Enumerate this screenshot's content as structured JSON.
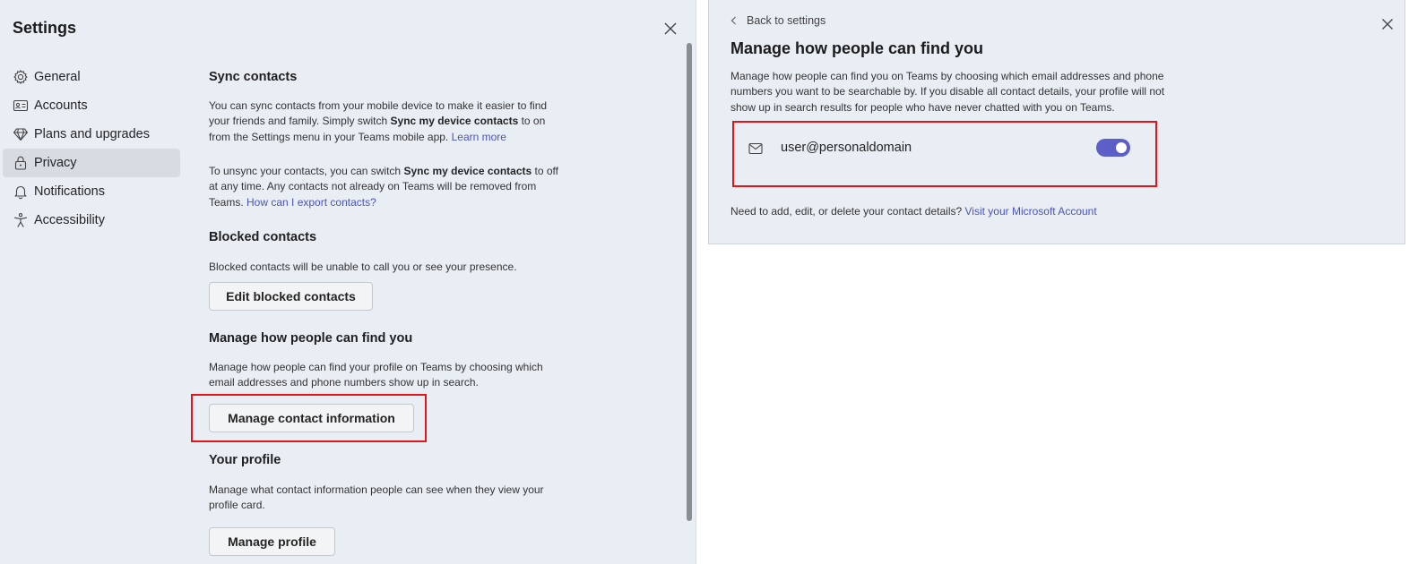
{
  "settings": {
    "title": "Settings",
    "nav": [
      {
        "label": "General",
        "icon": "gear-icon"
      },
      {
        "label": "Accounts",
        "icon": "id-card-icon"
      },
      {
        "label": "Plans and upgrades",
        "icon": "diamond-icon"
      },
      {
        "label": "Privacy",
        "icon": "lock-icon",
        "active": true
      },
      {
        "label": "Notifications",
        "icon": "bell-icon"
      },
      {
        "label": "Accessibility",
        "icon": "accessibility-icon"
      }
    ],
    "sync": {
      "heading": "Sync contacts",
      "p1_a": "You can sync contacts from your mobile device to make it easier to find your friends and family. Simply switch ",
      "p1_bold": "Sync my device contacts",
      "p1_b": " to on from the Settings menu in your Teams mobile app. ",
      "p1_link": "Learn more",
      "p2_a": "To unsync your contacts, you can switch ",
      "p2_bold": "Sync my device contacts",
      "p2_b": " to off at any time. Any contacts not already on Teams will be removed from Teams. ",
      "p2_link": "How can I export contacts?"
    },
    "blocked": {
      "heading": "Blocked contacts",
      "desc": "Blocked contacts will be unable to call you or see your presence.",
      "button": "Edit blocked contacts"
    },
    "find": {
      "heading": "Manage how people can find you",
      "desc": "Manage how people can find your profile on Teams by choosing which email addresses and phone numbers show up in search.",
      "button": "Manage contact information"
    },
    "profile": {
      "heading": "Your profile",
      "desc": "Manage what contact information people can see when they view your profile card.",
      "button": "Manage profile"
    }
  },
  "detail": {
    "back": "Back to settings",
    "title": "Manage how people can find you",
    "desc": "Manage how people can find you on Teams by choosing which email addresses and phone numbers you want to be searchable by. If you disable all contact details, your profile will not show up in search results for people who have never chatted with you on Teams.",
    "contact_email": "user@personaldomain",
    "contact_searchable": true,
    "footer_text": "Need to add, edit, or delete your contact details? ",
    "footer_link": "Visit your Microsoft Account"
  },
  "colors": {
    "accent": "#5b5fc7",
    "link": "#4b53bc",
    "highlight": "#e3151b",
    "panel_bg": "#e9eef4"
  }
}
